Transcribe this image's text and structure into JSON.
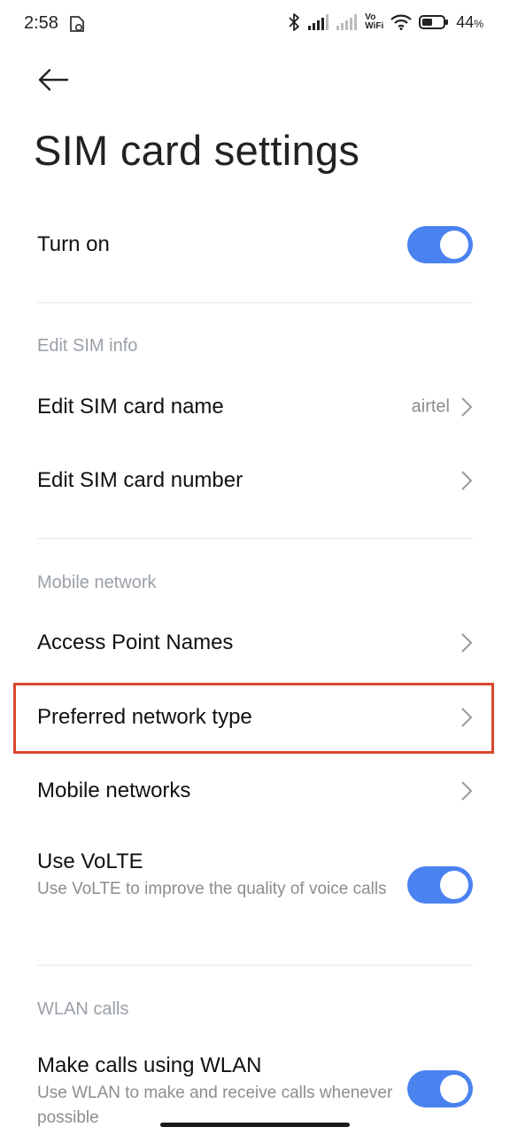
{
  "status_bar": {
    "time": "2:58",
    "battery_percent": "44",
    "battery_unit": "%",
    "vo_label": "Vo",
    "wifi_label": "WiFi",
    "icons": [
      "bluetooth-icon",
      "signal-icon",
      "signal-icon",
      "vowifi-icon",
      "wifi-icon",
      "battery-icon"
    ]
  },
  "header": {
    "title": "SIM card settings"
  },
  "turn_on": {
    "label": "Turn on",
    "enabled": true
  },
  "sections": {
    "edit_sim_info": {
      "header": "Edit SIM info",
      "name_label": "Edit SIM card name",
      "name_value": "airtel",
      "number_label": "Edit SIM card number"
    },
    "mobile_network": {
      "header": "Mobile network",
      "apn_label": "Access Point Names",
      "preferred_label": "Preferred network type",
      "networks_label": "Mobile networks",
      "volte_label": "Use VoLTE",
      "volte_sub": "Use VoLTE to improve the quality of voice calls",
      "volte_enabled": true
    },
    "wlan_calls": {
      "header": "WLAN calls",
      "wlan_label": "Make calls using WLAN",
      "wlan_sub": "Use WLAN to make and receive calls whenever possible",
      "wlan_enabled": true
    }
  },
  "colors": {
    "toggle_on": "#4a82f0",
    "highlight": "#d9472b",
    "section_header": "#9aa0a8"
  }
}
